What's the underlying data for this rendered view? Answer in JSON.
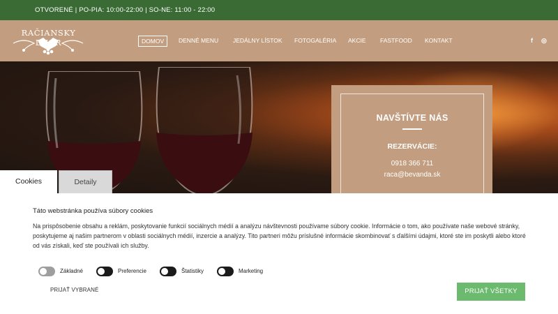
{
  "topbar": {
    "hours_text": "OTVORENÉ | PO-PIA: 10:00-22:00 | SO-NE: 11:00 - 22:00"
  },
  "logo": {
    "text": "RAČIANSKY DVOR"
  },
  "nav": {
    "items": [
      {
        "label": "DOMOV",
        "active": true
      },
      {
        "label": "DENNÉ MENU",
        "active": false
      },
      {
        "label": "JEDÁLNY LÍSTOK",
        "active": false
      },
      {
        "label": "FOTOGALÉRIA",
        "active": false
      },
      {
        "label": "AKCIE",
        "active": false
      },
      {
        "label": "FASTFOOD",
        "active": false
      },
      {
        "label": "KONTAKT",
        "active": false
      }
    ],
    "social": {
      "facebook_glyph": "f",
      "instagram_glyph": "◎"
    }
  },
  "visit": {
    "title": "NAVŠTÍVTE NÁS",
    "reservations_title": "REZERVÁCIE:",
    "phone": "0918 366 711",
    "email": "raca@bevanda.sk"
  },
  "cookies": {
    "tabs": [
      {
        "label": "Cookies",
        "active": true
      },
      {
        "label": "Detaily",
        "active": false
      }
    ],
    "heading": "Táto webstránka používa súbory cookies",
    "body": "Na prispôsobenie obsahu a reklám, poskytovanie funkcií sociálnych médií a analýzu návštevnosti používame súbory cookie. Informácie o tom, ako používate naše webové stránky, poskytujeme aj našim partnerom v oblasti sociálnych médií, inzercie a analýzy. Tito partneri môžu príslušné informácie skombinovať s ďalšími údajmi, ktoré ste im poskytli alebo ktoré od vás získali, keď ste používali ich služby.",
    "toggles": [
      {
        "label": "Základné",
        "on": true
      },
      {
        "label": "Preferencie",
        "on": false
      },
      {
        "label": "Štatistiky",
        "on": false
      },
      {
        "label": "Marketing",
        "on": false
      }
    ],
    "save_selected_label": "PRIJAŤ VYBRANÉ",
    "accept_all_label": "PRIJAŤ VŠETKY"
  },
  "colors": {
    "topbar": "#3a6b35",
    "brand_tan": "#c39d7f",
    "accept_green": "#6bba6e"
  }
}
